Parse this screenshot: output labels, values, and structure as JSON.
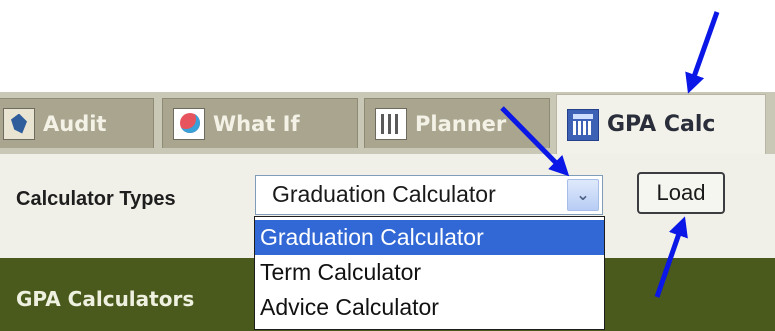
{
  "tabs": [
    {
      "label": "Audit",
      "icon": "audit-icon"
    },
    {
      "label": "What If",
      "icon": "what-if-icon"
    },
    {
      "label": "Planner",
      "icon": "planner-icon"
    },
    {
      "label": "GPA Calc",
      "icon": "calculator-icon",
      "active": true
    }
  ],
  "calculator": {
    "label": "Calculator Types",
    "selected": "Graduation Calculator",
    "options": [
      "Graduation Calculator",
      "Term Calculator",
      "Advice Calculator"
    ],
    "load_label": "Load"
  },
  "section": {
    "title": "GPA Calculators"
  },
  "colors": {
    "arrow": "#0a17e6",
    "section_band": "#4a5a1c",
    "selected_option": "#3168d5"
  }
}
